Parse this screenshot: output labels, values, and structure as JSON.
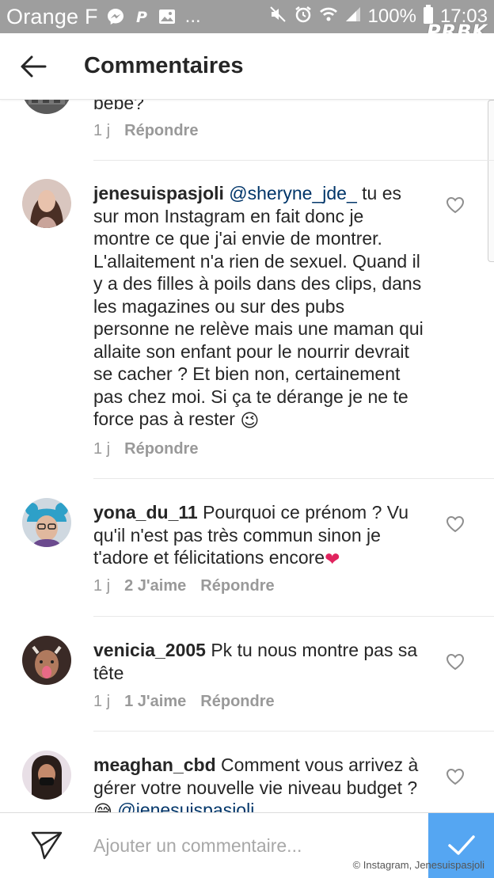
{
  "status_bar": {
    "carrier": "Orange F",
    "battery": "100%",
    "time": "17:03",
    "watermark": "PRBK",
    "icons": [
      "messenger-icon",
      "p-icon",
      "image-icon",
      "more-dots",
      "mute-icon",
      "alarm-icon",
      "wifi-icon",
      "signal-icon",
      "battery-icon"
    ]
  },
  "header": {
    "title": "Commentaires",
    "back_icon": "arrow-left-icon"
  },
  "comments": [
    {
      "user": "",
      "text_before": "bebe?",
      "mention": "",
      "text_after": "",
      "time": "1 j",
      "likes": "",
      "reply": "Répondre"
    },
    {
      "user": "jenesuispasjoli",
      "text_before": "",
      "mention": "@sheryne_jde_",
      "text_after": " tu es sur mon Instagram en fait donc je montre ce que j'ai envie de montrer. L'allaitement n'a rien de sexuel. Quand il y a des filles à poils dans des clips, dans les magazines ou sur des pubs personne ne relève mais une maman qui allaite son enfant pour le nourrir devrait se cacher ? Et bien non, certainement pas chez moi. Si ça te dérange je ne te force pas à rester ",
      "emoji": "😉",
      "time": "1 j",
      "likes": "",
      "reply": "Répondre"
    },
    {
      "user": "yona_du_11",
      "text_before": "Pourquoi ce prénom ? Vu qu'il n'est pas très commun  sinon je t'adore et félicitations encore",
      "mention": "",
      "text_after": "",
      "emoji": "❤",
      "time": "1 j",
      "likes": "2 J'aime",
      "reply": "Répondre"
    },
    {
      "user": "venicia_2005",
      "text_before": "Pk tu nous montre pas sa tête",
      "mention": "",
      "text_after": "",
      "time": "1 j",
      "likes": "1 J'aime",
      "reply": "Répondre"
    },
    {
      "user": "meaghan_cbd",
      "text_before": "Comment vous arrivez à gérer votre nouvelle vie niveau budget ?",
      "emoji": "😅",
      "mention": "@jenesuispasjoli",
      "text_after": "",
      "time": "",
      "likes": "",
      "reply": ""
    }
  ],
  "input_bar": {
    "placeholder": "Ajouter un commentaire...",
    "send_icon": "paper-plane-icon",
    "post_icon": "checkmark-icon"
  },
  "copyright": "© Instagram, Jenesuispasjoli",
  "colors": {
    "status_bar": "#9e9e9e",
    "text": "#262626",
    "meta": "#999999",
    "mention": "#003569",
    "post_button": "#3897f0"
  }
}
